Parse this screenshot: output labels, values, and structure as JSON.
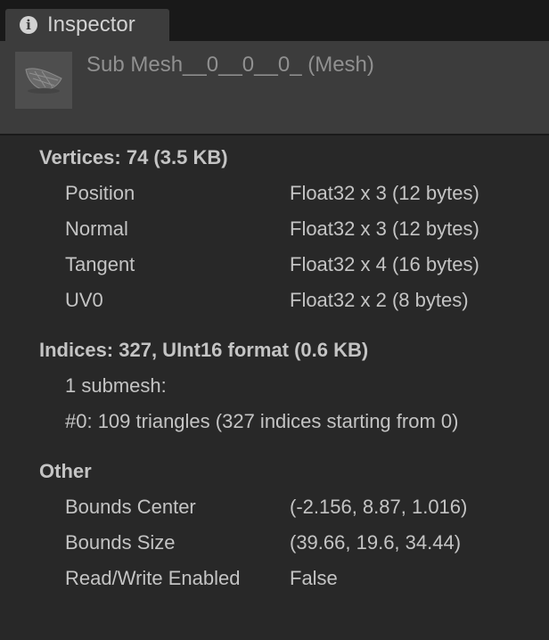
{
  "tab": {
    "icon": "info-icon",
    "icon_glyph": "i",
    "label": "Inspector"
  },
  "header": {
    "preview_icon": "mesh-preview-thumbnail",
    "title": "Sub Mesh__0__0__0_ (Mesh)"
  },
  "vertices": {
    "title": "Vertices: 74 (3.5 KB)",
    "rows": [
      {
        "label": "Position",
        "value": "Float32 x 3 (12 bytes)"
      },
      {
        "label": "Normal",
        "value": "Float32 x 3 (12 bytes)"
      },
      {
        "label": "Tangent",
        "value": "Float32 x 4 (16 bytes)"
      },
      {
        "label": "UV0",
        "value": "Float32 x 2 (8 bytes)"
      }
    ]
  },
  "indices": {
    "title": "Indices: 327, UInt16 format (0.6 KB)",
    "lines": [
      "1 submesh:",
      "#0: 109 triangles (327 indices starting from 0)"
    ]
  },
  "other": {
    "title": "Other",
    "rows": [
      {
        "label": "Bounds Center",
        "value": "(-2.156, 8.87, 1.016)"
      },
      {
        "label": "Bounds Size",
        "value": "(39.66, 19.6, 34.44)"
      },
      {
        "label": "Read/Write Enabled",
        "value": "False"
      }
    ]
  },
  "colors": {
    "background": "#282828",
    "tab_bar": "#191919",
    "tab_active": "#3c3c3c",
    "header": "#3c3c3c",
    "text": "#c4c4c4",
    "title_text": "#909090"
  }
}
